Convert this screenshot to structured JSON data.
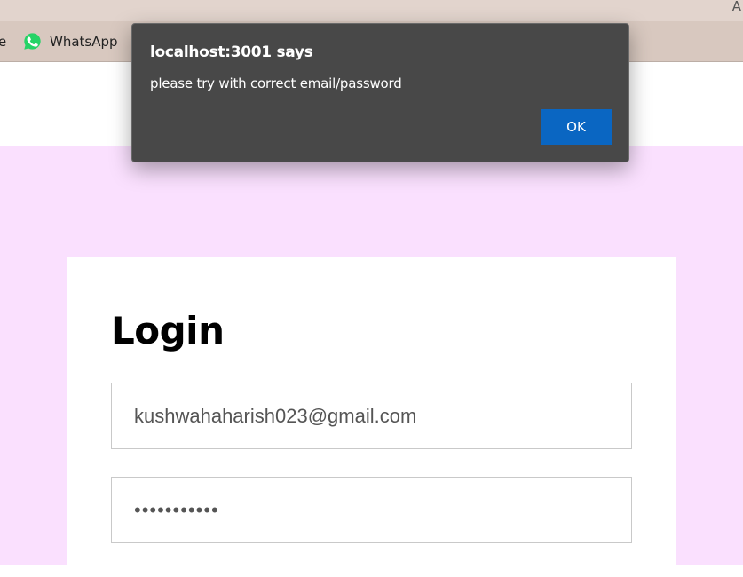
{
  "browser": {
    "top_edge_text": "A",
    "bookmarks": {
      "partial_label": "e",
      "whatsapp": {
        "label": "WhatsApp",
        "icon": "whatsapp-icon",
        "color": "#25D366"
      }
    }
  },
  "dialog": {
    "title": "localhost:3001 says",
    "message": "please try with correct email/password",
    "ok_label": "OK",
    "accent": "#0a66c2"
  },
  "page": {
    "background": "#fae0fe",
    "login": {
      "title": "Login",
      "email_value": "kushwahaharish023@gmail.com",
      "password_value": "•••••••••••"
    }
  }
}
